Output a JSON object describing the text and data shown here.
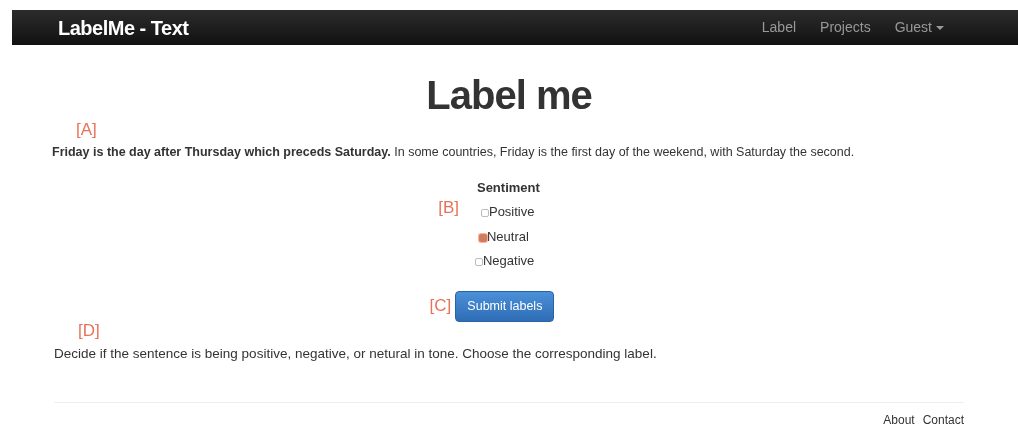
{
  "navbar": {
    "brand": "LabelMe - Text",
    "links": [
      {
        "label": "Label",
        "kind": "link"
      },
      {
        "label": "Projects",
        "kind": "link"
      },
      {
        "label": "Guest",
        "kind": "dropdown"
      }
    ]
  },
  "title": "Label me",
  "marker_a": "[A]",
  "sentence": "**Friday is the day after Thursday which preceds Saturday.** In some countries, Friday is the first day of the weekend, with Saturday the second.",
  "sentiment": {
    "heading": "Sentiment",
    "marker": "[B]",
    "options": [
      {
        "label": "Positive",
        "checked": false
      },
      {
        "label": "Neutral",
        "checked": true
      },
      {
        "label": "Negative",
        "checked": false
      }
    ]
  },
  "marker_c": "[C]",
  "submit": "Submit labels",
  "marker_d": "[D]",
  "instructions": "Decide if the sentence is being positive, negative, or netural in tone.  Choose the corresponding label.",
  "footer": {
    "links": [
      "About",
      "Contact"
    ]
  }
}
